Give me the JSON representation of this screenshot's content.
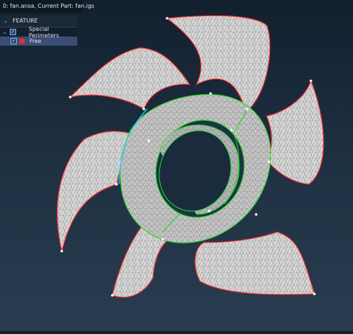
{
  "title_bar": {
    "text": "0: fan.ansa,  Current Part: fan.igs"
  },
  "feature_panel": {
    "header": "FEATURE",
    "items": [
      {
        "label": "Special Perimeters",
        "checked": true,
        "expanded": true
      },
      {
        "label": "Free",
        "checked": true,
        "color": "#ff2a2a",
        "selected": true
      }
    ]
  },
  "viewport": {
    "model": "fan",
    "perimeter_colors": {
      "free": "#ff3030",
      "shared": "#22dd22",
      "special": "#33ccff"
    }
  }
}
